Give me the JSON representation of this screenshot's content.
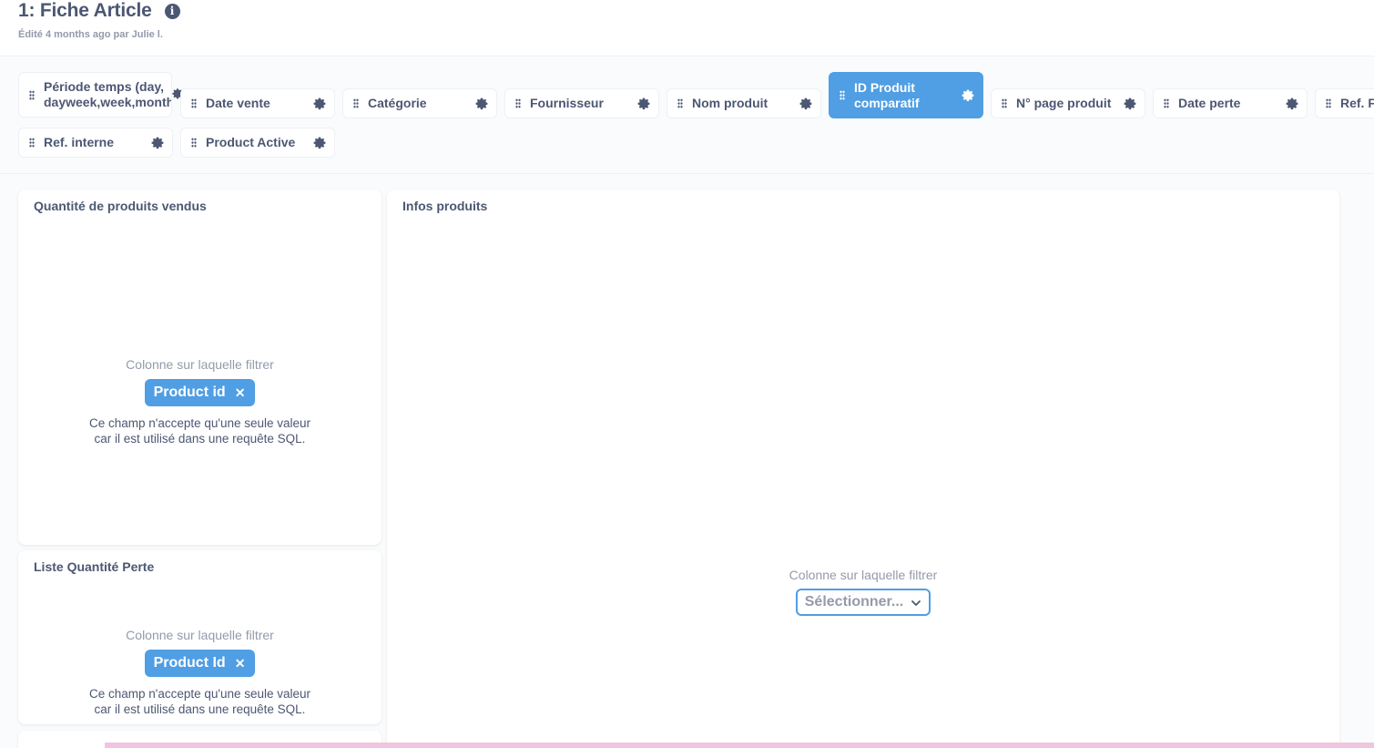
{
  "header": {
    "title": "1: Fiche Article",
    "info_icon": "info-icon",
    "edited_label": "Édité 4 months ago par Julie l."
  },
  "filters": [
    {
      "label": "Période temps (day, dayweek,week,month)",
      "active": false
    },
    {
      "label": "Date vente",
      "active": false
    },
    {
      "label": "Catégorie",
      "active": false
    },
    {
      "label": "Fournisseur",
      "active": false
    },
    {
      "label": "Nom produit",
      "active": false
    },
    {
      "label": "ID Produit comparatif",
      "active": true
    },
    {
      "label": "N° page produit",
      "active": false
    },
    {
      "label": "Date perte",
      "active": false
    },
    {
      "label": "Ref. Fo",
      "active": false
    },
    {
      "label": "Ref. interne",
      "active": false
    },
    {
      "label": "Product Active",
      "active": false
    }
  ],
  "cards": {
    "qty_sold": {
      "title": "Quantité de produits vendus",
      "column_label": "Colonne sur laquelle filtrer",
      "pill": "Product id",
      "note_line1": "Ce champ n'accepte qu'une seule valeur",
      "note_line2": "car il est utilisé dans une requête SQL."
    },
    "loss_list": {
      "title": "Liste Quantité Perte",
      "column_label": "Colonne sur laquelle filtrer",
      "pill": "Product Id",
      "note_line1": "Ce champ n'accepte qu'une seule valeur",
      "note_line2": "car il est utilisé dans une requête SQL."
    },
    "product_info": {
      "title": "Infos produits",
      "column_label": "Colonne sur laquelle filtrer",
      "select_placeholder": "Sélectionner..."
    }
  },
  "colors": {
    "accent": "#509ee3",
    "text": "#4c5773",
    "muted": "#949aab",
    "background": "#f9fbfc"
  }
}
